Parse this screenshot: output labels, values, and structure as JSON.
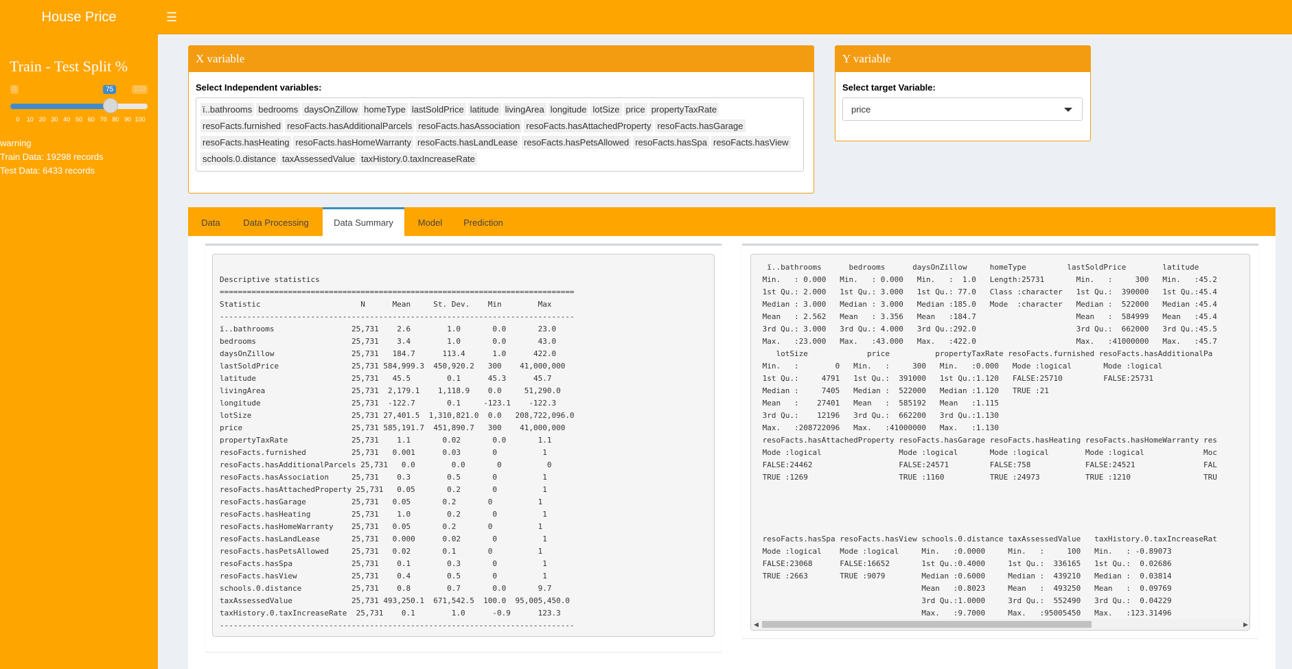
{
  "app": {
    "title": "House Price"
  },
  "sidebar": {
    "split_title": "Train - Test Split %",
    "slider": {
      "min": "0",
      "max": "100",
      "value": "75",
      "ticks": [
        "0",
        "10",
        "20",
        "30",
        "40",
        "50",
        "60",
        "70",
        "80",
        "90",
        "100"
      ]
    },
    "warning": "warning",
    "train": "Train Data: 19298 records",
    "test": "Test Data: 6433 records"
  },
  "xbox": {
    "title": "X variable",
    "label": "Select Independent variables:",
    "tags": [
      "ï..bathrooms",
      "bedrooms",
      "daysOnZillow",
      "homeType",
      "lastSoldPrice",
      "latitude",
      "livingArea",
      "longitude",
      "lotSize",
      "price",
      "propertyTaxRate",
      "resoFacts.furnished",
      "resoFacts.hasAdditionalParcels",
      "resoFacts.hasAssociation",
      "resoFacts.hasAttachedProperty",
      "resoFacts.hasGarage",
      "resoFacts.hasHeating",
      "resoFacts.hasHomeWarranty",
      "resoFacts.hasLandLease",
      "resoFacts.hasPetsAllowed",
      "resoFacts.hasSpa",
      "resoFacts.hasView",
      "schools.0.distance",
      "taxAssessedValue",
      "taxHistory.0.taxIncreaseRate"
    ]
  },
  "ybox": {
    "title": "Y variable",
    "label": "Select target Variable:",
    "selected": "price"
  },
  "tabs": [
    "Data",
    "Data Processing",
    "Data Summary",
    "Model",
    "Prediction"
  ],
  "active_tab": "Data Summary",
  "descriptive": "Descriptive statistics\n==============================================================================\nStatistic                      N      Mean     St. Dev.    Min        Max\n------------------------------------------------------------------------------\nï..bathrooms                 25,731    2.6        1.0       0.0       23.0\nbedrooms                     25,731    3.4        1.0       0.0       43.0\ndaysOnZillow                 25,731   184.7      113.4      1.0      422.0\nlastSoldPrice                25,731 584,999.3  450,920.2   300    41,000,000\nlatitude                     25,731   45.5        0.1      45.3      45.7\nlivingArea                   25,731  2,179.1    1,118.9    0.0     51,290.0\nlongitude                    25,731  -122.7       0.1     -123.1    -122.3\nlotSize                      25,731 27,401.5  1,310,821.0  0.0   208,722,096.0\nprice                        25,731 585,191.7  451,890.7   300    41,000,000\npropertyTaxRate              25,731    1.1       0.02       0.0       1.1\nresoFacts.furnished          25,731   0.001      0.03       0          1\nresoFacts.hasAdditionalParcels 25,731   0.0        0.0       0          0\nresoFacts.hasAssociation     25,731    0.3        0.5       0          1\nresoFacts.hasAttachedProperty 25,731   0.05       0.2       0          1\nresoFacts.hasGarage          25,731   0.05       0.2       0          1\nresoFacts.hasHeating         25,731    1.0        0.2       0          1\nresoFacts.hasHomeWarranty    25,731   0.05       0.2       0          1\nresoFacts.hasLandLease       25,731   0.000      0.02       0          1\nresoFacts.hasPetsAllowed     25,731   0.02       0.1       0          1\nresoFacts.hasSpa             25,731    0.1        0.3       0          1\nresoFacts.hasView            25,731    0.4        0.5       0          1\nschools.0.distance           25,731    0.8        0.7       0.0       9.7\ntaxAssessedValue             25,731 493,250.1  671,542.5  100.0  95,005,450.0\ntaxHistory.0.taxIncreaseRate  25,731    0.1        1.0      -0.9      123.3\n------------------------------------------------------------------------------",
  "summary": "  ï..bathrooms      bedrooms      daysOnZillow     homeType         lastSoldPrice        latitude\n Min.   : 0.000   Min.   : 0.000   Min.   :  1.0   Length:25731       Min.   :     300   Min.   :45.2\n 1st Qu.: 2.000   1st Qu.: 3.000   1st Qu.: 77.0   Class :character   1st Qu.:  390000   1st Qu.:45.4\n Median : 3.000   Median : 3.000   Median :185.0   Mode  :character   Median :  522000   Median :45.4\n Mean   : 2.562   Mean   : 3.356   Mean   :184.7                      Mean   :  584999   Mean   :45.4\n 3rd Qu.: 3.000   3rd Qu.: 4.000   3rd Qu.:292.0                      3rd Qu.:  662000   3rd Qu.:45.5\n Max.   :23.000   Max.   :43.000   Max.   :422.0                      Max.   :41000000   Max.   :45.7\n    lotSize             price          propertyTaxRate resoFacts.furnished resoFacts.hasAdditionalPa\n Min.   :        0   Min.   :     300   Min.   :0.000   Mode :logical       Mode :logical\n 1st Qu.:     4791   1st Qu.:  391000   1st Qu.:1.120   FALSE:25710         FALSE:25731\n Median :     7405   Median :  522000   Median :1.120   TRUE :21\n Mean   :    27401   Mean   :  585192   Mean   :1.115\n 3rd Qu.:    12196   3rd Qu.:  662200   3rd Qu.:1.130\n Max.   :208722096   Max.   :41000000   Max.   :1.130\n resoFacts.hasAttachedProperty resoFacts.hasGarage resoFacts.hasHeating resoFacts.hasHomeWarranty res\n Mode :logical                 Mode :logical       Mode :logical        Mode :logical             Moc\n FALSE:24462                   FALSE:24571         FALSE:758            FALSE:24521               FAL\n TRUE :1269                    TRUE :1160          TRUE :24973          TRUE :1210                TRU\n\n\n\n\n resoFacts.hasSpa resoFacts.hasView schools.0.distance taxAssessedValue   taxHistory.0.taxIncreaseRat\n Mode :logical    Mode :logical     Min.   :0.0000     Min.   :     100   Min.   : -0.89073\n FALSE:23068      FALSE:16652       1st Qu.:0.4000     1st Qu.:  336165   1st Qu.:  0.02686\n TRUE :2663       TRUE :9079        Median :0.6000     Median :  439210   Median :  0.03814\n                                    Mean   :0.8023     Mean   :  493250   Mean   :  0.09769\n                                    3rd Qu.:1.0000     3rd Qu.:  552490   3rd Qu.:  0.04229\n                                    Max.   :9.7000     Max.   :95005450   Max.   :123.31496"
}
